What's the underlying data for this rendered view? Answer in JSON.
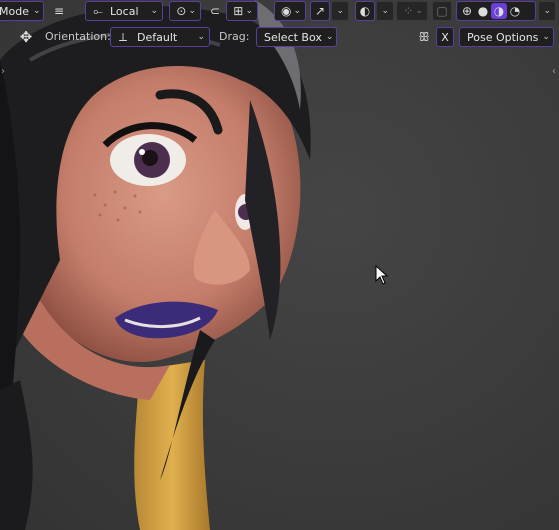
{
  "header": {
    "mode_label": "Mode",
    "transform_orientation": "Local",
    "pose_options_label": "Pose Options",
    "x_mirror_label": "X"
  },
  "tool_settings": {
    "orientation_label": "Orientation:",
    "orientation_value": "Default",
    "drag_label": "Drag:",
    "drag_value": "Select Box"
  },
  "viewport": {
    "background_color": "#3d3d3d",
    "accent_color": "#5b3fa0"
  }
}
